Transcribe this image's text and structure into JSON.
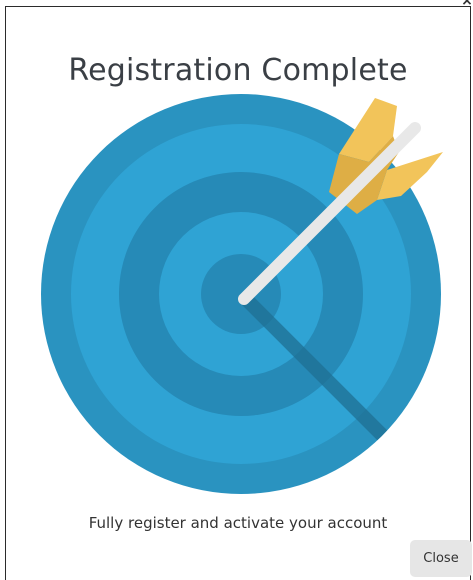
{
  "dialog": {
    "title": "Registration Complete",
    "message": "Fully register and activate your account",
    "close_label": "Close",
    "close_x": "×"
  },
  "illustration": {
    "icon": "target-with-arrow-icon",
    "colors": {
      "ring_outer": "#2a93c0",
      "ring_second": "#2fa3d4",
      "ring_third": "#268ab7",
      "ring_fourth": "#2fa3d4",
      "bullseye": "#268ab7",
      "shadow": "#1f6f93",
      "arrow_shaft": "#e8e8e8",
      "fletching_light": "#f2c45a",
      "fletching_dark": "#deae45"
    }
  }
}
